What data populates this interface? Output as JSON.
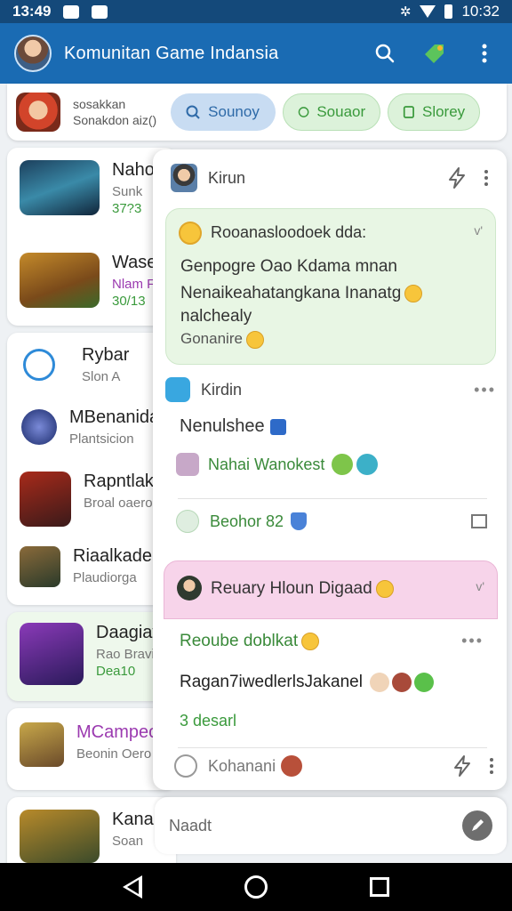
{
  "status": {
    "time_left": "13:49",
    "time_right": "10:32"
  },
  "header": {
    "title": "Komunitan Game Indansia"
  },
  "filters": {
    "line1": "sosakkan",
    "line2": "Sonakdon aiz()",
    "chips": [
      "Sounoy",
      "Souaor",
      "Slorey"
    ]
  },
  "list": {
    "items": [
      {
        "name": "Nahor",
        "sub": "Sunk",
        "meta": "37?3"
      },
      {
        "name": "Waseayl",
        "sub": "Nlam Flaiti",
        "meta": "30/13"
      },
      {
        "name": "Rybar",
        "sub": "Slon A"
      },
      {
        "name": "MBenanida",
        "sub": "Plantsicion"
      },
      {
        "name": "Rapntlak",
        "sub": "Broal oaeror"
      },
      {
        "name": "Riaalkader",
        "sub": "Plaudiorga"
      },
      {
        "name": "Daagiaf",
        "sub": "Rao Bravi",
        "meta": "Dea10"
      },
      {
        "name": "MCampeok",
        "sub": "Beonin Oero"
      },
      {
        "name": "Kanal",
        "sub": "Soan"
      }
    ]
  },
  "panel": {
    "user": "Kirun",
    "bubble": {
      "heading": "Rooanasloodoek dda:",
      "line1": "Genpogre Oao Kdama mnan",
      "line2": "Nenaikeahatangkana Inanatg",
      "line3": "nalchealy",
      "line4": "Gonanire"
    },
    "sec2": {
      "user": "Kirdin",
      "line": "Nenulshee",
      "link": "Nahai Wanokest",
      "foot": "Beohor 82"
    },
    "pink": {
      "title": "Reuary Hloun Digaad"
    },
    "sec3": {
      "line1": "Reoube doblkat",
      "line2": "Ragan7iwedlerlsJakanel",
      "line3": "3 desarl",
      "foot": "Kohanani"
    },
    "compose_placeholder": "Naadt"
  }
}
